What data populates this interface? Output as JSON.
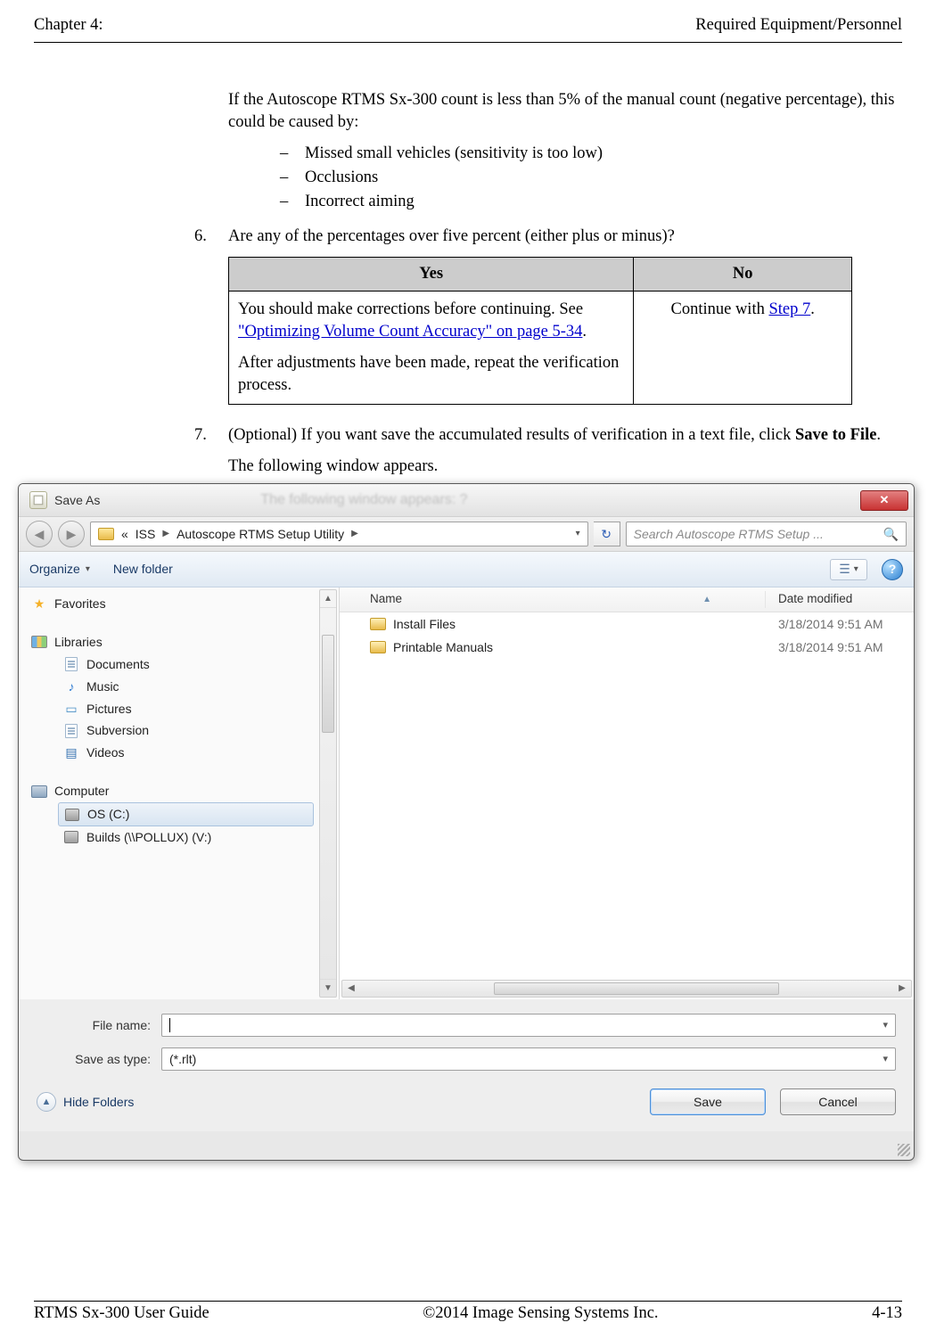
{
  "header": {
    "left": "Chapter 4:",
    "right": "Required Equipment/Personnel"
  },
  "footer": {
    "left": "RTMS Sx-300 User Guide",
    "center": "©2014 Image Sensing Systems Inc.",
    "right": "4-13"
  },
  "body": {
    "intro": "If the Autoscope RTMS Sx-300 count is less than 5% of the manual count (negative percentage), this could be caused by:",
    "causes": [
      "Missed small vehicles (sensitivity is too low)",
      "Occlusions",
      "Incorrect aiming"
    ],
    "step6_num": "6.",
    "step6_text": "Are any of the percentages over five percent (either plus or minus)?",
    "step7_num": "7.",
    "step7_a": "(Optional) If you want save the accumulated results of verification in a text file, click ",
    "step7_b": "Save to File",
    "step7_c": ".",
    "after7": "The following window appears."
  },
  "table": {
    "yes": "Yes",
    "no": "No",
    "yes_p1a": "You should make corrections before continuing. See ",
    "yes_link": "\"Optimizing Volume Count Accuracy\" on page 5-34",
    "yes_p1b": ".",
    "yes_p2": "After adjustments have been made, repeat the verification process.",
    "no_a": "Continue with ",
    "no_link": "Step 7",
    "no_b": "."
  },
  "dialog": {
    "title": "Save As",
    "blur": "The following window appears: ?",
    "close": "✕",
    "nav_back": "◀",
    "nav_fwd": "▶",
    "crumb_prefix": "«",
    "crumb1": "ISS",
    "crumb2": "Autoscope RTMS Setup Utility",
    "refresh": "↻",
    "search_placeholder": "Search Autoscope RTMS Setup ...",
    "search_icon": "🔍",
    "organize": "Organize",
    "newfolder": "New folder",
    "help": "?",
    "tree": {
      "favorites": "Favorites",
      "libraries": "Libraries",
      "documents": "Documents",
      "music": "Music",
      "pictures": "Pictures",
      "subversion": "Subversion",
      "videos": "Videos",
      "computer": "Computer",
      "osc": "OS (C:)",
      "builds": "Builds (\\\\POLLUX) (V:)"
    },
    "cols": {
      "name": "Name",
      "date": "Date modified"
    },
    "rows": [
      {
        "name": "Install Files",
        "date": "3/18/2014 9:51 AM"
      },
      {
        "name": "Printable Manuals",
        "date": "3/18/2014 9:51 AM"
      }
    ],
    "filename_label": "File name:",
    "filename_value": "",
    "type_label": "Save as type:",
    "type_value": "(*.rlt)",
    "hide": "Hide Folders",
    "save": "Save",
    "cancel": "Cancel"
  }
}
